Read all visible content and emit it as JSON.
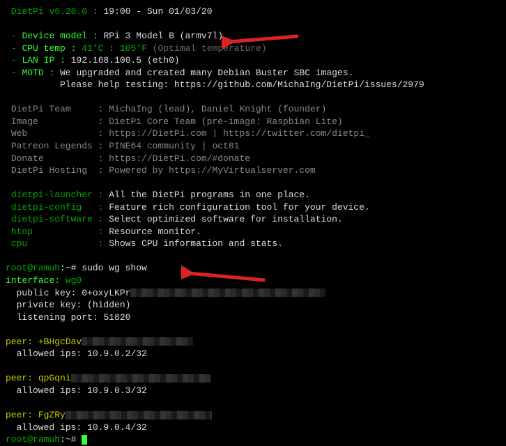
{
  "header": {
    "title_left": " DietPi v6.28.0",
    "title_right": "19:00 - Sun 01/03/20"
  },
  "sys": {
    "device_label": "Device model :",
    "device_value": "RPi 3 Model B (armv7l)",
    "cputemp_label": "CPU temp :",
    "cputemp_c": "41'C",
    "cputemp_f": "105'F",
    "cputemp_note": "(Optimal temperature)",
    "lanip_label": "LAN IP :",
    "lanip_value": "192.168.100.5 (eth0)",
    "motd_label": "MOTD :",
    "motd_line1": "We upgraded and created many Debian Buster SBC images.",
    "motd_line2": "Please help testing: https://github.com/MichaIng/DietPi/issues/2979"
  },
  "credits": {
    "team_label": "DietPi Team     :",
    "team_value": "MichaIng (lead), Daniel Knight (founder)",
    "image_label": "Image           :",
    "image_value": "DietPi Core Team (pre-image: Raspbian Lite)",
    "web_label": "Web             :",
    "web_value": "https://DietPi.com | https://twitter.com/dietpi_",
    "patreon_label": "Patreon Legends :",
    "patreon_value": "PINE64 community | oct81",
    "donate_label": "Donate          :",
    "donate_value": "https://DietPi.com/#donate",
    "hosting_label": "DietPi Hosting  :",
    "hosting_value": "Powered by https://MyVirtualserver.com"
  },
  "tools": {
    "launcher_label": "dietpi-launcher :",
    "launcher_value": "All the DietPi programs in one place.",
    "config_label": "dietpi-config   :",
    "config_value": "Feature rich configuration tool for your device.",
    "software_label": "dietpi-software :",
    "software_value": "Select optimized software for installation.",
    "htop_label": "htop            :",
    "htop_value": "Resource monitor.",
    "cpu_label": "cpu             :",
    "cpu_value": "Shows CPU information and stats."
  },
  "prompt1": {
    "user": "root@ramuh",
    "sep": ":~#",
    "cmd": " sudo wg show"
  },
  "wg": {
    "iface_label": "interface:",
    "iface_value": " wg0",
    "pubkey_label": "  public key: ",
    "pubkey_value": "0+oxyLKPr",
    "privkey_label": "  private key: ",
    "privkey_value": "(hidden)",
    "port_label": "  listening port: ",
    "port_value": "51820",
    "peer1_label": "peer:",
    "peer1_value": " +BHgcDav",
    "peer1_ips_label": "  allowed ips: ",
    "peer1_ips_value": "10.9.0.2/32",
    "peer2_label": "peer:",
    "peer2_value": " qpGqni",
    "peer2_ips_label": "  allowed ips: ",
    "peer2_ips_value": "10.9.0.3/32",
    "peer3_label": "peer:",
    "peer3_value": " FgZRy",
    "peer3_ips_label": "  allowed ips: ",
    "peer3_ips_value": "10.9.0.4/32"
  },
  "prompt2": {
    "user": "root@ramuh",
    "sep": ":~#"
  }
}
